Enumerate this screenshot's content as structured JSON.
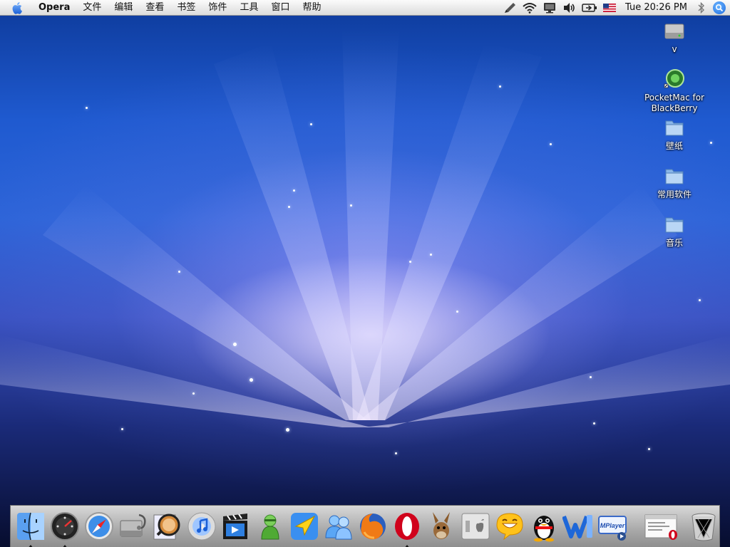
{
  "menubar": {
    "app_name": "Opera",
    "items": [
      "文件",
      "编辑",
      "查看",
      "书签",
      "饰件",
      "工具",
      "窗口",
      "帮助"
    ],
    "clock": "Tue 20:26 PM",
    "status_icons": [
      "pen-icon",
      "wifi-icon",
      "display-icon",
      "volume-icon",
      "battery-icon",
      "us-flag-icon",
      "bluetooth-icon",
      "spotlight-icon"
    ]
  },
  "desktop": {
    "icons": [
      {
        "name": "v",
        "icon": "hard-drive-icon"
      },
      {
        "name": "PocketMac for BlackBerry",
        "icon": "pocketmac-icon"
      },
      {
        "name": "壁纸",
        "icon": "folder-icon"
      },
      {
        "name": "常用软件",
        "icon": "folder-icon"
      },
      {
        "name": "音乐",
        "icon": "folder-icon"
      }
    ]
  },
  "dock": {
    "apps": [
      {
        "id": "finder",
        "icon": "finder-icon",
        "running": true
      },
      {
        "id": "dashboard",
        "icon": "dashboard-icon",
        "running": true
      },
      {
        "id": "safari",
        "icon": "safari-icon",
        "running": false
      },
      {
        "id": "disk-utility",
        "icon": "disk-utility-icon",
        "running": false
      },
      {
        "id": "preview",
        "icon": "preview-icon",
        "running": false
      },
      {
        "id": "itunes",
        "icon": "itunes-icon",
        "running": false
      },
      {
        "id": "imovie",
        "icon": "imovie-icon",
        "running": false
      },
      {
        "id": "green-chat",
        "icon": "green-chat-icon",
        "running": false
      },
      {
        "id": "navigator",
        "icon": "navigator-icon",
        "running": false
      },
      {
        "id": "messenger",
        "icon": "messenger-icon",
        "running": false
      },
      {
        "id": "firefox",
        "icon": "firefox-icon",
        "running": false
      },
      {
        "id": "opera",
        "icon": "opera-icon",
        "running": true
      },
      {
        "id": "amule",
        "icon": "amule-icon",
        "running": false
      },
      {
        "id": "bootcamp",
        "icon": "bootcamp-icon",
        "running": false
      },
      {
        "id": "smiley-chat",
        "icon": "smiley-icon",
        "running": false
      },
      {
        "id": "qq",
        "icon": "qq-penguin-icon",
        "running": false
      },
      {
        "id": "word",
        "icon": "word-icon",
        "running": false
      },
      {
        "id": "mplayer",
        "icon": "mplayer-icon",
        "label": "MPlayer",
        "running": false
      }
    ],
    "right": [
      {
        "id": "minimized-window",
        "icon": "minimized-window-icon"
      },
      {
        "id": "trash",
        "icon": "trash-icon"
      }
    ]
  },
  "colors": {
    "menubar_bg": "#e8e8e8",
    "dock_bg": "#b8b8b8",
    "wallpaper_blue": "#2c64d8",
    "opera_red": "#d0021b"
  }
}
